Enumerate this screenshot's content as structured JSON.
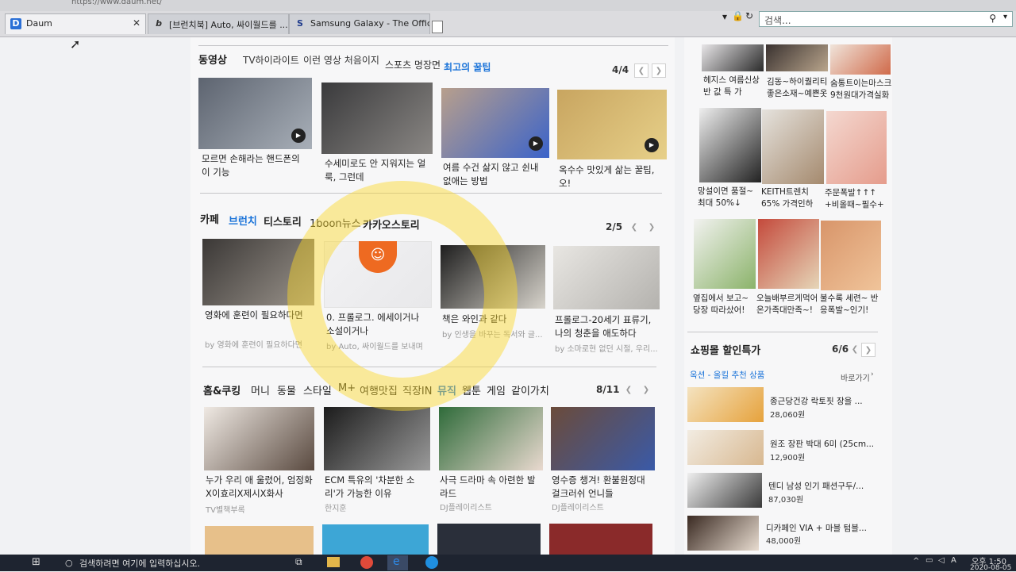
{
  "browser": {
    "url": "https://www.daum.net/",
    "tabs": [
      {
        "icon": "D",
        "label": "Daum"
      },
      {
        "icon": "b",
        "label": "[브런치북] Auto, 싸이월드를 ..."
      },
      {
        "icon": "S",
        "label": "Samsung Galaxy - The Official..."
      }
    ],
    "search_placeholder": "검색..."
  },
  "video": {
    "title": "동영상",
    "tabs": [
      "TV하이라이트",
      "이런 영상 처음이지",
      "스포츠 명장면",
      "최고의 꿀팁"
    ],
    "page": "4/4",
    "items": [
      {
        "caption": "모르면 손해라는 핸드폰의 이 기능",
        "color1": "#5d6470",
        "color2": "#a8afb8"
      },
      {
        "caption": "수세미로도 안 지워지는 얼룩, 그런데",
        "color1": "#3a3a3c",
        "color2": "#8a8784"
      },
      {
        "caption": "여름 수건 삶지 않고 쉰내 없애는 방법",
        "color1": "#b89f8c",
        "color2": "#3b63c9"
      },
      {
        "caption": "옥수수 맛있게 삶는 꿀팁, 오!",
        "color1": "#c8a560",
        "color2": "#e7d089"
      }
    ]
  },
  "cafe": {
    "tabs": [
      "카페",
      "브런치",
      "티스토리",
      "1boon뉴스",
      "카카오스토리"
    ],
    "page": "2/5",
    "items": [
      {
        "caption": "영화에 훈련이 필요하다면",
        "source": "by 영화에 훈련이 필요하다면",
        "color1": "#3b3836",
        "color2": "#9b948c"
      },
      {
        "caption": "0. 프롤로그. 에세이거나 소설이거나",
        "source": "by Auto, 싸이월드를 보내며",
        "color1": "#f2f2f4",
        "color2": "#e8e8ea"
      },
      {
        "caption": "책은 와인과 같다",
        "source": "by 인생을 바꾸는 독서와 글...",
        "color1": "#1e1e1e",
        "color2": "#d8d4cc"
      },
      {
        "caption": "프롤로그-20세기 표류기, 나의 청춘을 애도하다",
        "source": "by 소마로현 없던 시절, 우리...",
        "color1": "#e8e6e2",
        "color2": "#b4b2ae"
      }
    ]
  },
  "life": {
    "tabs": [
      "홈&쿠킹",
      "머니",
      "동물",
      "스타일",
      "M+",
      "여행맛집",
      "직장IN",
      "뮤직",
      "웹툰",
      "게임",
      "같이가치"
    ],
    "page": "8/11",
    "items": [
      {
        "caption": "누가 우리 애 울렸어, 엄정화X이효리X제시X화사",
        "source": "TV별책부록",
        "color1": "#efe9e3",
        "color2": "#5a4a40"
      },
      {
        "caption": "ECM 특유의 '차분한 소리'가 가능한 이유",
        "source": "한지훈",
        "color1": "#1c1c1c",
        "color2": "#9a9a9a"
      },
      {
        "caption": "사극 드라마 속 아련한 발라드",
        "source": "DJ플레이리스트",
        "color1": "#2f6b3a",
        "color2": "#e9d9cf"
      },
      {
        "caption": "영수증 챙겨! 환불원정대 걸크러쉬 언니들",
        "source": "DJ플레이리스트",
        "color1": "#6b4b3a",
        "color2": "#3a5aa8"
      }
    ],
    "more_colors": [
      "#e7c08a",
      "#3da6d6",
      "#2a2f3a",
      "#8a2a2a"
    ]
  },
  "shopping_top": {
    "items": [
      {
        "caption": "헤지스 여름신상 반 값 특 가",
        "color1": "#e8e6e8",
        "color2": "#2b2b2b"
      },
      {
        "caption": "김동~하이퀄리티 좋은소재~예쁜옷",
        "color1": "#3a3230",
        "color2": "#b9a58c"
      },
      {
        "caption": "숨통트이는마스크 9천원대가격실화",
        "color1": "#f0e4da",
        "color2": "#d06a4a"
      },
      {
        "caption": "망설이면 품절~ 최대 50%↓",
        "color1": "#efefef",
        "color2": "#222222"
      },
      {
        "caption": "KEITH트렌치 65% 가격인하",
        "color1": "#e5e2dd",
        "color2": "#a58a6e"
      },
      {
        "caption": "주문폭발↑↑↑ +비올때~필수+",
        "color1": "#f4d8d0",
        "color2": "#e59c8c"
      },
      {
        "caption": "옆집에서 보고~ 당장 따라샀어!",
        "color1": "#f2f2f0",
        "color2": "#8bb36a"
      },
      {
        "caption": "오늘배부르게먹어 온가족대만족~!",
        "color1": "#c44a3c",
        "color2": "#e6d6b8"
      },
      {
        "caption": "불수록 세련~ 반응폭발~인기!",
        "color1": "#d8956a",
        "color2": "#f0c49a"
      }
    ]
  },
  "shopping": {
    "title": "쇼핑몰 할인특가",
    "page": "6/6",
    "subtitle": "옥션 - 올킬 추천 상품",
    "more": "바로가기",
    "products": [
      {
        "title": "종근당건강 락토핏 장을 ...",
        "price": "28,060원",
        "color1": "#f4e3c0",
        "color2": "#e6a23c"
      },
      {
        "title": "원조 장판 박대 6미 (25cm...",
        "price": "12,900원",
        "color1": "#f2ece2",
        "color2": "#d8b890"
      },
      {
        "title": "텐디 남성 인기 패션구두/...",
        "price": "87,030원",
        "color1": "#efefef",
        "color2": "#3a3a3a"
      },
      {
        "title": "디카페인 VIA + 마블 텀블...",
        "price": "48,000원",
        "color1": "#3a2a22",
        "color2": "#e8dcd0"
      }
    ]
  },
  "taskbar": {
    "search": "검색하려면 여기에 입력하십시오.",
    "time": "오후 1:50",
    "date": "2020-08-05"
  }
}
